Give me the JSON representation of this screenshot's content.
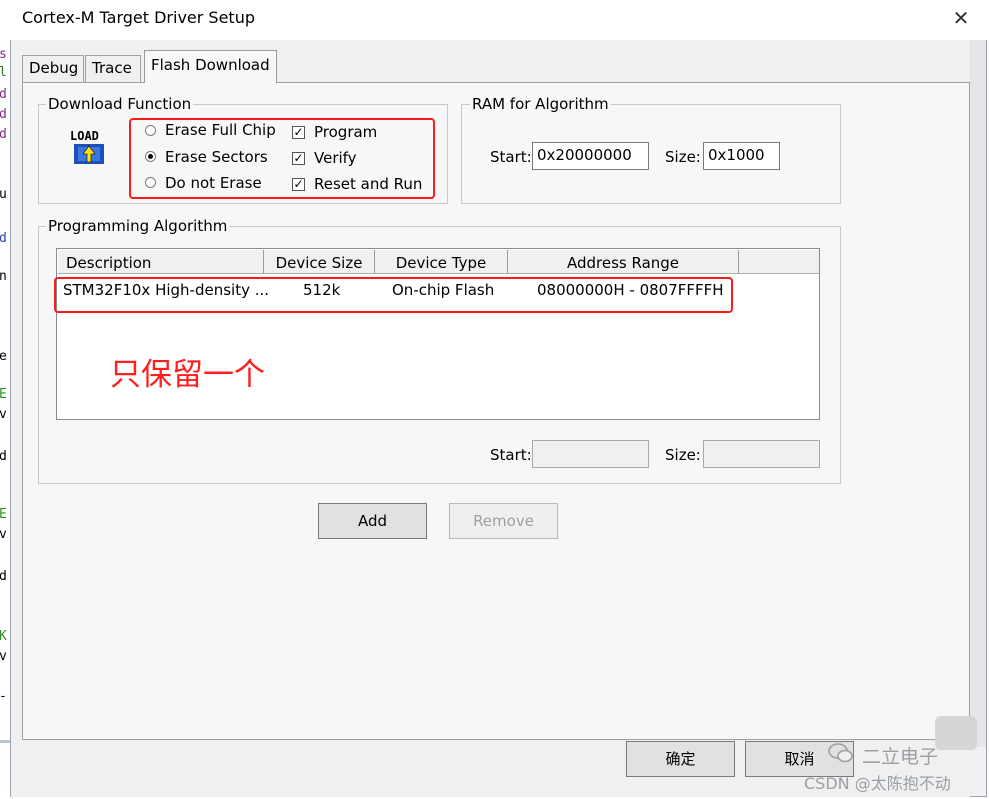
{
  "window": {
    "title": "Cortex-M Target Driver Setup",
    "close_glyph": "✕"
  },
  "tabs": [
    {
      "label": "Debug"
    },
    {
      "label": "Trace"
    },
    {
      "label": "Flash Download"
    }
  ],
  "download_function": {
    "group_label": "Download Function",
    "load_icon_text": "LOAD",
    "erase_options": [
      {
        "label": "Erase Full Chip",
        "selected": false
      },
      {
        "label": "Erase Sectors",
        "selected": true
      },
      {
        "label": "Do not Erase",
        "selected": false
      }
    ],
    "checks": [
      {
        "label": "Program",
        "checked": true
      },
      {
        "label": "Verify",
        "checked": true
      },
      {
        "label": "Reset and Run",
        "checked": true
      }
    ]
  },
  "ram": {
    "group_label": "RAM for Algorithm",
    "start_label": "Start:",
    "start_value": "0x20000000",
    "size_label": "Size:",
    "size_value": "0x1000"
  },
  "algorithm": {
    "group_label": "Programming Algorithm",
    "columns": [
      "Description",
      "Device Size",
      "Device Type",
      "Address Range"
    ],
    "rows": [
      {
        "description": "STM32F10x High-density ...",
        "size": "512k",
        "type": "On-chip Flash",
        "range": "08000000H - 0807FFFFH"
      }
    ],
    "start_label": "Start:",
    "start_value": "",
    "size_label": "Size:",
    "size_value": ""
  },
  "annotation": "只保留一个",
  "buttons": {
    "add": "Add",
    "remove": "Remove",
    "ok": "确定",
    "cancel": "取消"
  },
  "watermark": {
    "line1": "二立电子",
    "line2": "CSDN @太陈抱不动"
  },
  "colors": {
    "annotation_red": "#ff1a1a",
    "panel": "#f7f7f7",
    "window": "#f0f0f0"
  }
}
